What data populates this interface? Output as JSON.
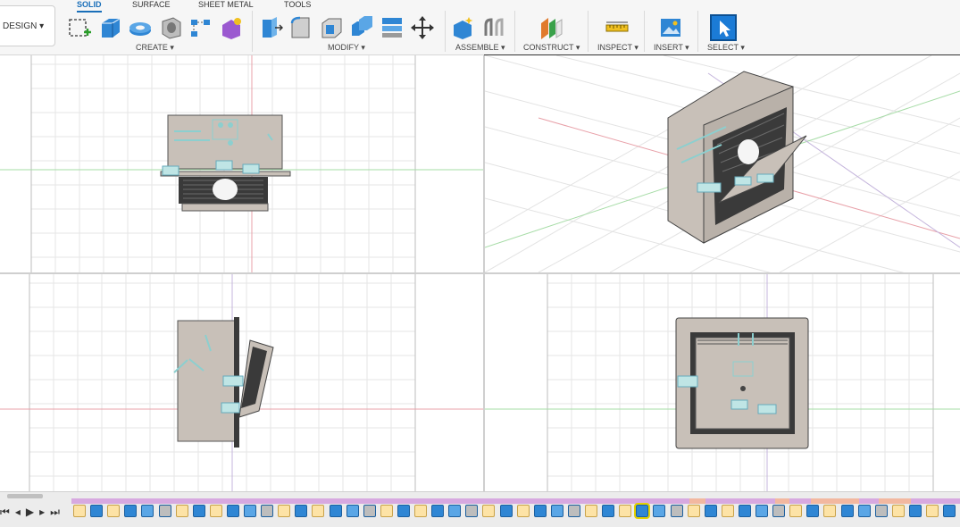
{
  "workspace": {
    "label": "DESIGN ▾"
  },
  "tabs": [
    {
      "label": "SOLID",
      "active": true
    },
    {
      "label": "SURFACE",
      "active": false
    },
    {
      "label": "SHEET METAL",
      "active": false
    },
    {
      "label": "TOOLS",
      "active": false
    }
  ],
  "groups": {
    "create": "CREATE ▾",
    "modify": "MODIFY ▾",
    "assemble": "ASSEMBLE ▾",
    "construct": "CONSTRUCT ▾",
    "inspect": "INSPECT ▾",
    "insert": "INSERT ▾",
    "select": "SELECT ▾"
  },
  "tools": {
    "create": [
      "create-sketch-icon",
      "extrude-icon",
      "revolve-icon",
      "hole-icon",
      "pattern-icon",
      "create-form-icon"
    ],
    "modify": [
      "press-pull-icon",
      "fillet-icon",
      "shell-icon",
      "combine-icon",
      "replace-face-icon",
      "move-copy-icon"
    ],
    "assemble": [
      "new-component-icon",
      "joint-icon"
    ],
    "construct": [
      "offset-plane-icon"
    ],
    "inspect": [
      "measure-icon"
    ],
    "insert": [
      "insert-image-icon"
    ],
    "select": [
      "select-icon"
    ]
  },
  "viewports": [
    "top-view",
    "perspective-view",
    "left-view",
    "front-view"
  ],
  "navigation_bar": [
    "orbit-icon",
    "look-at-icon",
    "pan-icon",
    "zoom-icon",
    "fit-icon",
    "display-settings-icon",
    "grid-settings-icon",
    "viewports-icon"
  ],
  "timeline": {
    "controls": [
      "skip-to-start-icon",
      "step-back-icon",
      "play-icon",
      "step-forward-icon",
      "skip-to-end-icon"
    ],
    "selected_index": 33,
    "item_count": 52
  },
  "colors": {
    "accent": "#1a6fb9",
    "toolbar_bg": "#f6f6f6",
    "grid_line": "#e6e6e6",
    "axis_red": "#e8a0a8",
    "axis_green": "#a6dca6",
    "axis_purple": "#c4b4dc",
    "model_body": "#c8c0b8",
    "model_dark": "#3a3a3a",
    "sketch_cyan": "#8ccfcf",
    "timeline_track": "#d7a9e0",
    "timeline_highlight": "#e3d200"
  }
}
